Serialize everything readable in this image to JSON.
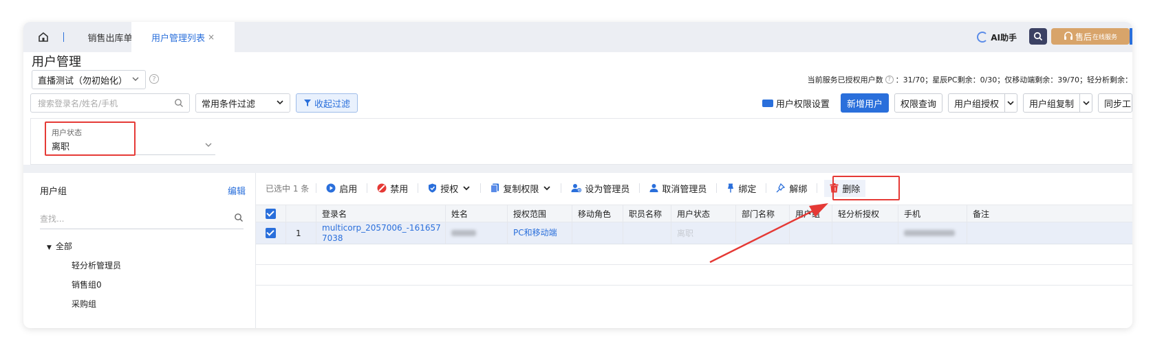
{
  "tabs": {
    "home_icon": "home-icon",
    "sales_tab": "销售出库单",
    "active_tab": "用户管理列表",
    "close_glyph": "×"
  },
  "topbar": {
    "ai_label": "AI助手",
    "service_label": "售后",
    "service_small": "在线服务"
  },
  "header": {
    "title": "用户管理",
    "org_select": "直播测试（勿初始化）",
    "quota_prefix": "当前服务已授权用户数",
    "quota_rest": "：31/70；星辰PC剩余：0/30；仅移动端剩余：39/70；轻分析剩余："
  },
  "filters": {
    "search_placeholder": "搜索登录名/姓名/手机",
    "condition_select": "常用条件过滤",
    "collapse_label": "收起过滤",
    "user_status_label": "用户状态",
    "user_status_value": "离职"
  },
  "toolbar": {
    "permission_settings": "用户权限设置",
    "add_user": "新增用户",
    "permission_query": "权限查询",
    "group_authorize": "用户组授权",
    "group_copy": "用户组复制",
    "sync": "同步工"
  },
  "left_panel": {
    "title": "用户组",
    "edit": "编辑",
    "search_placeholder": "查找...",
    "tree_root": "全部",
    "items": [
      "轻分析管理员",
      "销售组0",
      "采购组"
    ]
  },
  "actions": {
    "selected_count": "已选中 1 条",
    "enable": "启用",
    "disable": "禁用",
    "authorize": "授权",
    "copy_permission": "复制权限",
    "set_admin": "设为管理员",
    "cancel_admin": "取消管理员",
    "bind": "绑定",
    "unbind": "解绑",
    "delete": "删除"
  },
  "table": {
    "columns": [
      "登录名",
      "姓名",
      "授权范围",
      "移动角色",
      "职员名称",
      "用户状态",
      "部门名称",
      "用户组",
      "轻分析授权",
      "手机",
      "备注"
    ],
    "rows": [
      {
        "index": "1",
        "login": "multicorp_2057006_-1616577038",
        "scope": "PC和移动端",
        "status": "离职"
      }
    ]
  },
  "colors": {
    "accent": "#2a6fdb",
    "annotation_red": "#e53935",
    "service_orange": "#d8a46a"
  }
}
